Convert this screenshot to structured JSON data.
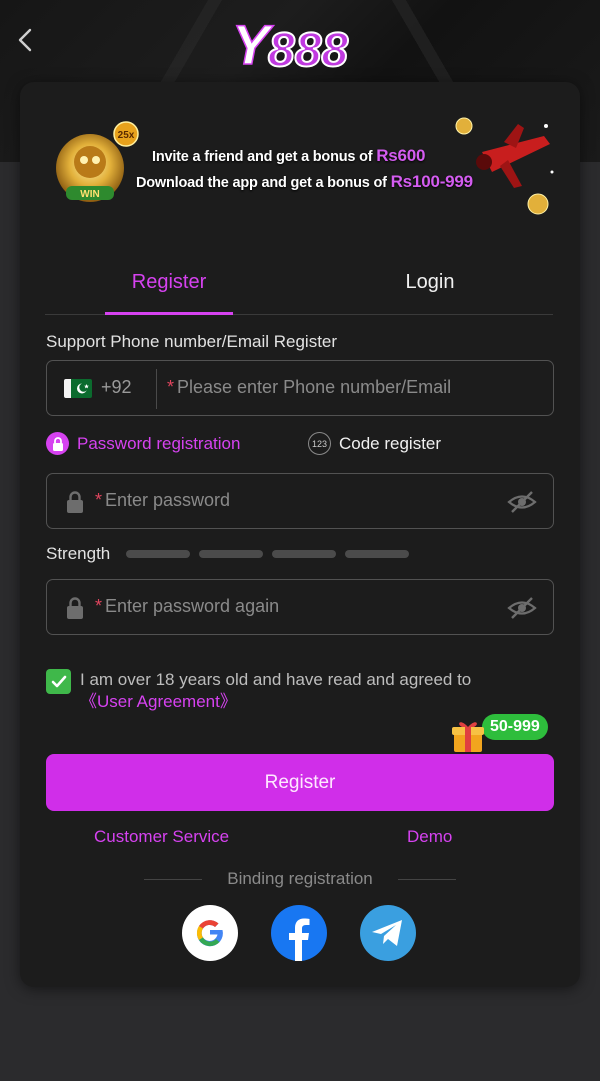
{
  "header": {
    "logo_text": "Y888",
    "back_icon": "chevron-left-icon"
  },
  "banner": {
    "line1_prefix": "Invite a friend and get a bonus of ",
    "line1_amount": "Rs600",
    "line2_prefix": "Download the app and get a bonus of ",
    "line2_amount": "Rs100-999",
    "badge_text": "25x",
    "win_text": "WIN"
  },
  "tabs": [
    {
      "label": "Register",
      "active": true
    },
    {
      "label": "Login",
      "active": false
    }
  ],
  "form": {
    "phone_label": "Support Phone number/Email Register",
    "country_code": "+92",
    "phone_placeholder": "Please enter Phone number/Email",
    "required_mark": "*",
    "mode_password": "Password registration",
    "mode_code": "Code register",
    "code_icon_text": "123",
    "password_placeholder": "Enter password",
    "strength_label": "Strength",
    "strength_level": 0,
    "confirm_placeholder": "Enter password again",
    "agree_text": "I am over 18 years old and have read and agreed to",
    "agree_link": "《User Agreement》",
    "agree_checked": true
  },
  "bonus_badge": "50-999",
  "register_button": "Register",
  "links": {
    "customer_service": "Customer Service",
    "demo": "Demo"
  },
  "binding": {
    "label": "Binding registration",
    "providers": [
      "google-icon",
      "facebook-icon",
      "telegram-icon"
    ]
  },
  "colors": {
    "accent": "#d642f0",
    "button": "#d02ee9",
    "check": "#3fb84a",
    "badge": "#2ebd3c"
  }
}
